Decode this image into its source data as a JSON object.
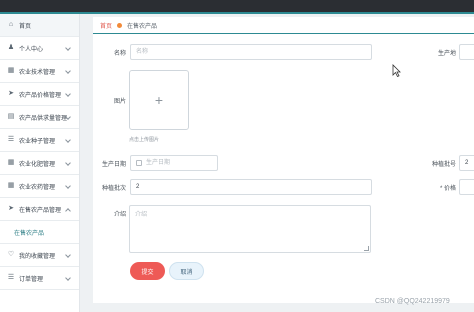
{
  "sidebar": {
    "items": [
      {
        "label": "首页",
        "icon": "home-icon"
      },
      {
        "label": "个人中心",
        "icon": "user-icon"
      },
      {
        "label": "农业技术管理",
        "icon": "grid-icon"
      },
      {
        "label": "农产品价格管理",
        "icon": "send-icon"
      },
      {
        "label": "农产品供求量管理",
        "icon": "chart-icon"
      },
      {
        "label": "农业种子管理",
        "icon": "list-icon"
      },
      {
        "label": "农业化肥管理",
        "icon": "grid-icon"
      },
      {
        "label": "农业农药管理",
        "icon": "grid-icon"
      },
      {
        "label": "在售农产品管理",
        "icon": "send-icon"
      },
      {
        "label": "在售农产品",
        "icon": ""
      },
      {
        "label": "我的收藏管理",
        "icon": "heart-icon"
      },
      {
        "label": "订单管理",
        "icon": "list-icon"
      }
    ]
  },
  "breadcrumb": {
    "home": "首页",
    "current": "在售农产品"
  },
  "form": {
    "name_label": "名称",
    "name_placeholder": "名称",
    "producer_label": "生产地",
    "image_label": "图片",
    "upload_hint": "点击上传图片",
    "date_label": "生产日期",
    "date_placeholder": "生产日期",
    "batch_label": "种植批号",
    "batch_value": "2",
    "plant_label": "种植批次",
    "plant_value": "2",
    "price_label": "* 价格",
    "desc_label": "介绍",
    "desc_placeholder": "介绍"
  },
  "buttons": {
    "submit": "提交",
    "cancel": "取消"
  },
  "watermark": "CSDN @QQ242219979"
}
